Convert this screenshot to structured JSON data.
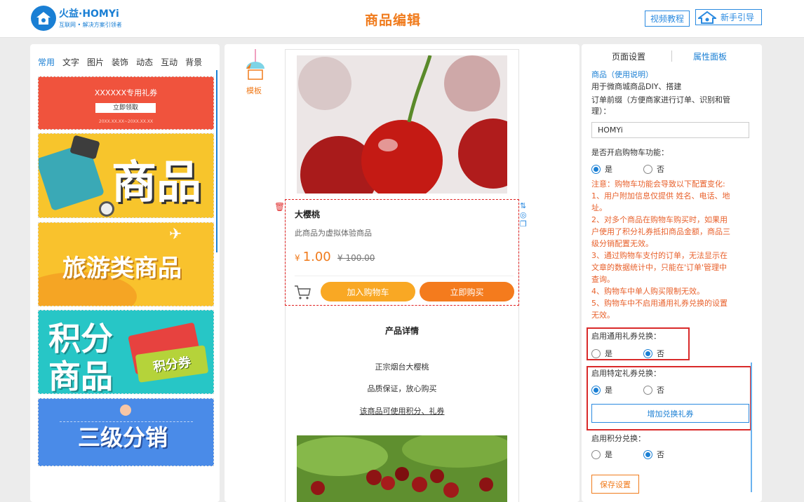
{
  "brand": {
    "name": "火益·HOMYi",
    "tagline": "互联网 • 解决方案引领者"
  },
  "header": {
    "title": "商品编辑",
    "tutorial_label": "视频教程",
    "guide_label": "新手引导"
  },
  "left": {
    "tabs": [
      "常用",
      "文字",
      "图片",
      "装饰",
      "动态",
      "互动",
      "背景"
    ],
    "active_tab": "常用",
    "tiles": {
      "coupon_title": "XXXXXX专用礼券",
      "coupon_button": "立即领取",
      "coupon_date": "20XX.XX.XX~20XX.XX.XX",
      "goods": "商品",
      "travel": "旅游类商品",
      "points_line1": "积分",
      "points_line2": "商品",
      "points_ticket": "积分券",
      "distribution": "三级分销"
    }
  },
  "middle": {
    "template_label": "模板",
    "product": {
      "name": "大樱桃",
      "desc": "此商品为虚拟体验商品",
      "currency": "¥",
      "price": "1.00",
      "original_price": "¥ 100.00",
      "add_cart": "加入购物车",
      "buy_now": "立即购买"
    },
    "detail": {
      "title": "产品详情",
      "line1": "正宗烟台大樱桃",
      "line2": "品质保证，放心购买",
      "line3": "该商品可使用积分、礼券"
    }
  },
  "right": {
    "tabs": {
      "page": "页面设置",
      "attr": "属性面板"
    },
    "goods_label": "商品（使用说明）",
    "goods_desc": "用于微商城商品DIY、搭建",
    "prefix_label_1": "订单前缀（方便商家进行订单、识别和管",
    "prefix_label_2": "理）：",
    "prefix_value": "HOMYi",
    "cart_label": "是否开启购物车功能：",
    "yes": "是",
    "no": "否",
    "notes": [
      "注意：购物车功能会导致以下配置变化:",
      "1、用户附加信息仅提供 姓名、电话、地",
      "址。",
      "2、对多个商品在购物车购买时，如果用",
      "户使用了积分礼券抵扣商品金额，商品三",
      "级分销配置无效。",
      "3、通过购物车支付的订单，无法显示在",
      "文章的数据统计中，只能在'订单'管理中",
      "查询。",
      "4、购物车中单人购买限制无效。",
      "5、购物车中不启用通用礼券兑换的设置",
      "无效。"
    ],
    "general_coupon_label": "启用通用礼券兑换：",
    "specific_coupon_label": "启用特定礼券兑换：",
    "add_coupon_button": "增加兑换礼券",
    "points_label": "启用积分兑换：",
    "save_button": "保存设置",
    "cart_enabled": true,
    "general_coupon_enabled": false,
    "specific_coupon_enabled": true,
    "points_enabled": false
  },
  "colors": {
    "accent": "#f07b1c",
    "brand": "#1a7fd4",
    "highlight_border": "#d92a2a"
  }
}
